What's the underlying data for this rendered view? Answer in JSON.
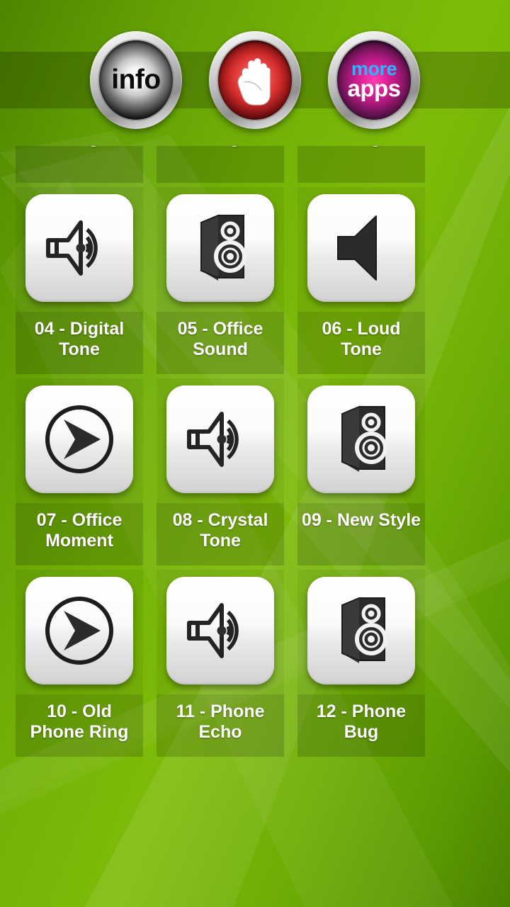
{
  "app": {
    "background_color": "#6eaa0b",
    "header_band_color": "rgba(0,0,0,0.20)"
  },
  "topbar": {
    "buttons": [
      {
        "name": "info-button",
        "label": "info",
        "icon": "info-text",
        "color": "#171717"
      },
      {
        "name": "stop-hand-button",
        "label": "",
        "icon": "hand-icon",
        "color": "#cf2a2a"
      },
      {
        "name": "more-apps-button",
        "label_line1": "more",
        "label_line2": "apps",
        "icon": "more-apps-text",
        "color_line1": "#29b6ff",
        "color_line2": "#ffffff",
        "color": "#e0219a"
      }
    ]
  },
  "grid": {
    "clipped_top_row": [
      {
        "label": "Ring",
        "icon": "speaker-waves-outline-icon"
      },
      {
        "label": "Ring",
        "icon": "speaker-box-icon"
      },
      {
        "label": "Ring",
        "icon": "speaker-solid-icon"
      }
    ],
    "items": [
      {
        "label": "04 - Digital Tone",
        "icon": "speaker-waves-outline-icon"
      },
      {
        "label": "05 - Office Sound",
        "icon": "speaker-box-icon"
      },
      {
        "label": "06 - Loud Tone",
        "icon": "speaker-solid-icon"
      },
      {
        "label": "07 - Office Moment",
        "icon": "play-arrow-circle-icon"
      },
      {
        "label": "08 - Crystal Tone",
        "icon": "speaker-waves-outline-icon"
      },
      {
        "label": "09 - New Style",
        "icon": "speaker-box-icon"
      },
      {
        "label": "10 - Old Phone Ring",
        "icon": "play-arrow-circle-icon"
      },
      {
        "label": "11 - Phone Echo",
        "icon": "speaker-waves-outline-icon"
      },
      {
        "label": "12 - Phone Bug",
        "icon": "speaker-box-icon"
      }
    ]
  }
}
